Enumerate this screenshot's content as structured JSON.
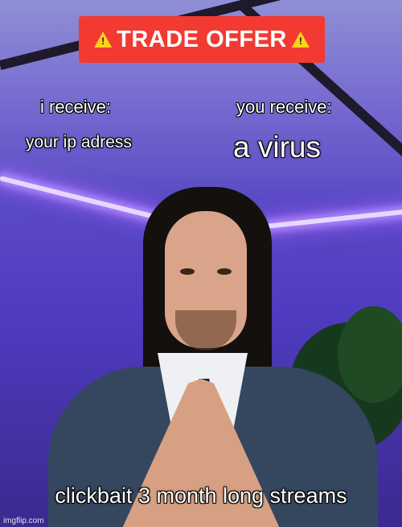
{
  "banner": {
    "text": "TRADE OFFER"
  },
  "left_header": "i receive:",
  "right_header": "you receive:",
  "left_item": "your ip adress",
  "right_item": "a virus",
  "bottom_caption": "clickbait 3 month long streams",
  "watermark": "imgflip.com",
  "colors": {
    "banner": "#f23a32",
    "warning": "#ffd21a",
    "led": "#b58bff"
  }
}
